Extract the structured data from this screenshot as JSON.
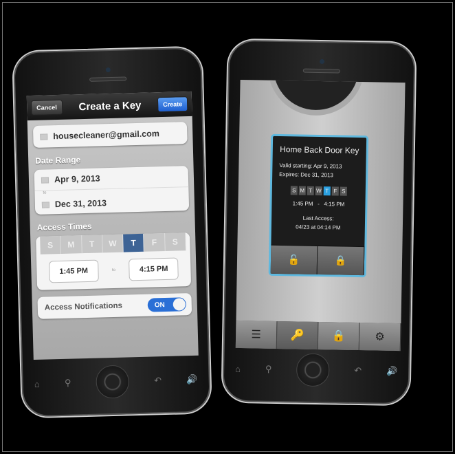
{
  "left_phone": {
    "nav": {
      "cancel": "Cancel",
      "title": "Create a Key",
      "create": "Create"
    },
    "email": "housecleaner@gmail.com",
    "date_range": {
      "label": "Date Range",
      "start": "Apr 9, 2013",
      "to": "to",
      "end": "Dec 31, 2013"
    },
    "access_times": {
      "label": "Access Times",
      "days": [
        "S",
        "M",
        "T",
        "W",
        "T",
        "F",
        "S"
      ],
      "selected_day_index": 4,
      "start": "1:45 PM",
      "to": "to",
      "end": "4:15 PM"
    },
    "notifications": {
      "label": "Access Notifications",
      "toggle": "ON"
    },
    "hardware": {
      "home": "⌂",
      "search": "⚲",
      "back": "↶",
      "volume": "🔊"
    }
  },
  "right_phone": {
    "key": {
      "title": "Home Back Door Key",
      "valid": "Valid starting: Apr 9, 2013",
      "expires": "Expires: Dec 31, 2013",
      "days": [
        "S",
        "M",
        "T",
        "W",
        "T",
        "F",
        "S"
      ],
      "selected_day_index": 4,
      "times": "1:45 PM   -   4:15 PM",
      "last_access_label": "Last Access:",
      "last_access": "04/23 at 04:14 PM"
    },
    "key_buttons": {
      "unlock": "🔓",
      "lock": "🔒"
    },
    "tabs": [
      {
        "icon": "☰",
        "name": "list"
      },
      {
        "icon": "🔑",
        "name": "key",
        "active": true
      },
      {
        "icon": "🔒",
        "name": "lock"
      },
      {
        "icon": "⚙",
        "name": "settings"
      }
    ],
    "hardware": {
      "home": "⌂",
      "search": "⚲",
      "back": "↶",
      "volume": "🔊"
    }
  },
  "colors": {
    "accent_blue": "#2a6fd6",
    "selected_day": "#3d6395",
    "key_glow": "#5fb8de",
    "key_active": "#4ab5e8"
  }
}
